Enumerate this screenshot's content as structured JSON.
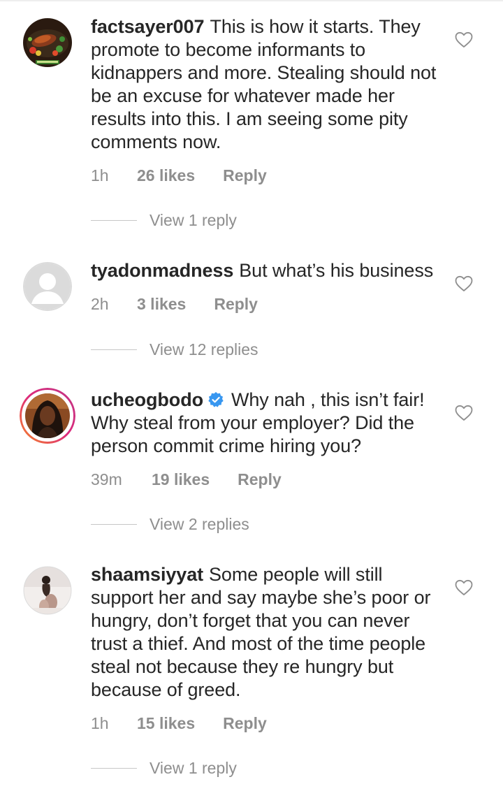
{
  "comments": [
    {
      "username": "factsayer007",
      "text": "This is how it starts. They promote to become informants to kidnappers and more. Stealing should not be an excuse for whatever made her results into this. I am seeing some pity comments now.",
      "time": "1h",
      "likes": "26 likes",
      "reply_label": "Reply",
      "view_replies": "View 1 reply",
      "verified": false,
      "avatar_icon": "food-platter-avatar"
    },
    {
      "username": "tyadonmadness",
      "text": "But what’s his business",
      "time": "2h",
      "likes": "3 likes",
      "reply_label": "Reply",
      "view_replies": "View 12 replies",
      "verified": false,
      "avatar_icon": "default-person-avatar"
    },
    {
      "username": "ucheogbodo",
      "text": "Why nah , this isn’t fair! Why steal from your employer? Did the person commit crime hiring you?",
      "time": "39m",
      "likes": "19 likes",
      "reply_label": "Reply",
      "view_replies": "View 2 replies",
      "verified": true,
      "avatar_icon": "photo-avatar-with-story-ring"
    },
    {
      "username": "shaamsiyyat",
      "text": "Some people will still support her and say maybe she’s poor or hungry, don’t forget that  you can never trust a thief.  And most of the time people steal not because they re hungry but because of greed.",
      "time": "1h",
      "likes": "15 likes",
      "reply_label": "Reply",
      "view_replies": "View 1 reply",
      "verified": false,
      "avatar_icon": "photo-avatar"
    }
  ],
  "colors": {
    "text": "#262626",
    "muted": "#8e8e8e",
    "verified_blue": "#3897f0",
    "story_ring_start": "#f58529",
    "story_ring_end": "#dd2a7b"
  }
}
